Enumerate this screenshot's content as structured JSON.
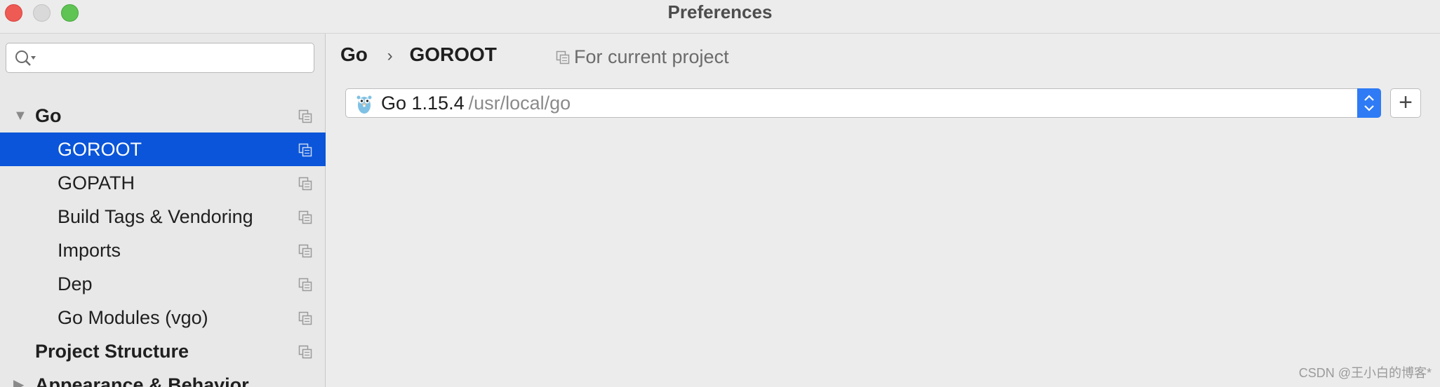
{
  "window": {
    "title": "Preferences"
  },
  "search": {
    "value": "",
    "placeholder": ""
  },
  "sidebar": {
    "items": [
      {
        "label": "Go",
        "level": 0,
        "expanded": true,
        "bold": true
      },
      {
        "label": "GOROOT",
        "level": 1,
        "selected": true
      },
      {
        "label": "GOPATH",
        "level": 1
      },
      {
        "label": "Build Tags & Vendoring",
        "level": 1
      },
      {
        "label": "Imports",
        "level": 1
      },
      {
        "label": "Dep",
        "level": 1
      },
      {
        "label": "Go Modules (vgo)",
        "level": 1
      },
      {
        "label": "Project Structure",
        "level": 0,
        "bold": true
      },
      {
        "label": "Appearance & Behavior",
        "level": 0,
        "bold": true,
        "collapsed": true
      }
    ],
    "icons": {
      "copy": "copy-icon",
      "expanded": "triangle-down-icon",
      "collapsed": "triangle-right-icon"
    }
  },
  "main": {
    "breadcrumb": [
      "Go",
      "GOROOT"
    ],
    "breadcrumb_separator": "›",
    "scope_label": "For current project",
    "sdk": {
      "version": "Go 1.15.4",
      "path": "/usr/local/go",
      "icon": "gopher-icon"
    },
    "add_label": "+"
  },
  "watermark": "CSDN @王小白的博客*",
  "colors": {
    "selection": "#0a55d9",
    "stepper": "#2f7bf5",
    "close": "#ee5a54",
    "maximize": "#5fc453"
  }
}
